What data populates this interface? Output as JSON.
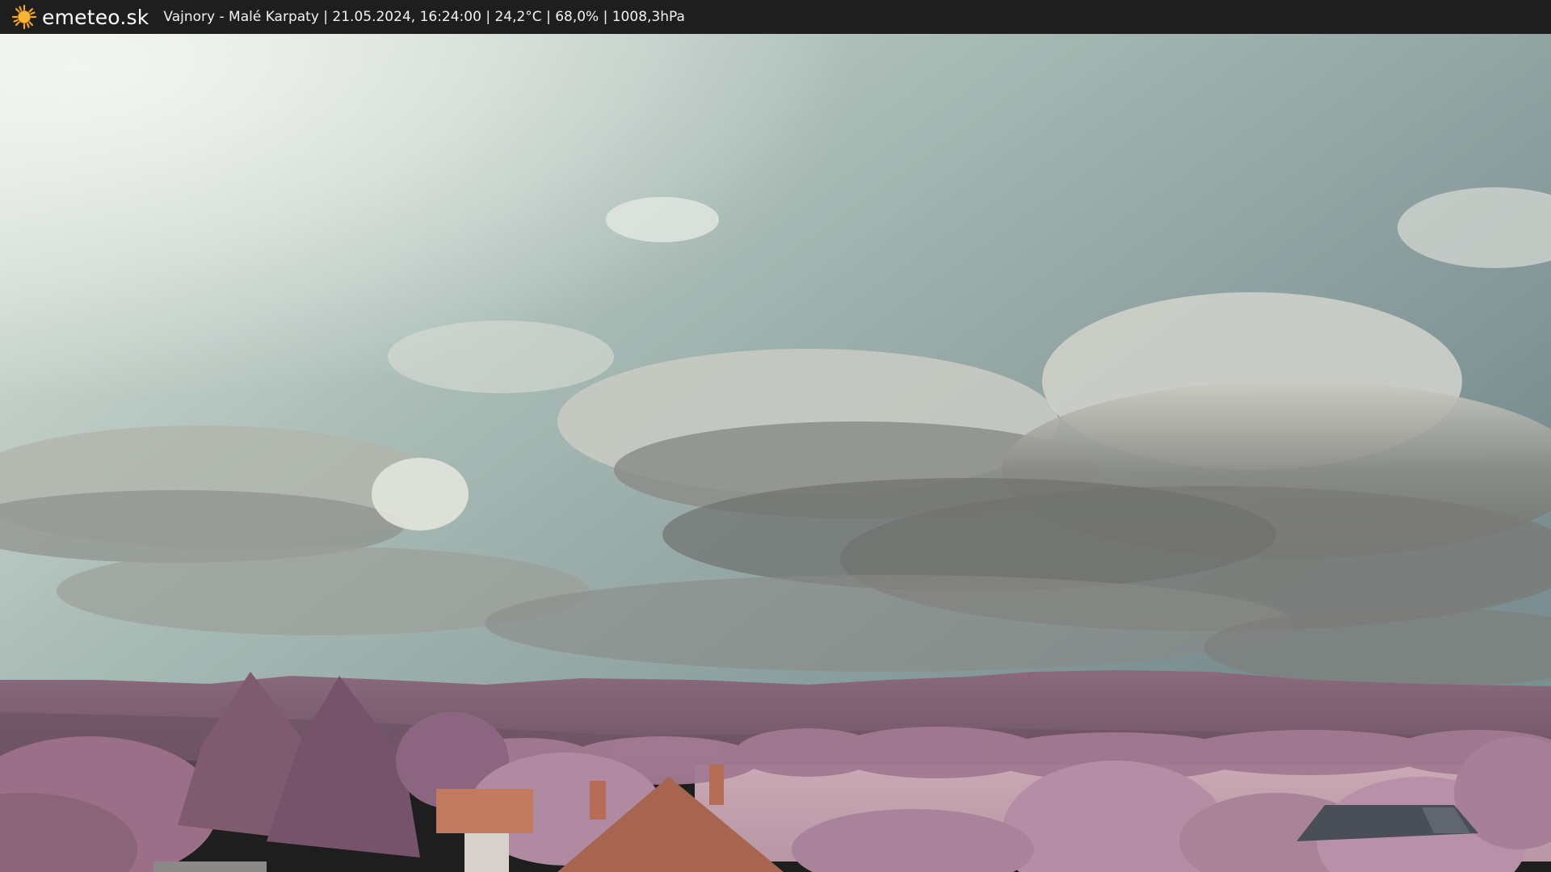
{
  "header": {
    "brand": "emeteo.sk",
    "logo_icon": "sun-icon",
    "info_text": "Vajnory - Malé Karpaty | 21.05.2024, 16:24:00 | 24,2°C | 68,0% | 1008,3hPa"
  },
  "colors": {
    "bar_background": "#1e1e1e",
    "logo_sun": "#f5a623",
    "foliage": "#a87b96",
    "sky": "#9fb2ad"
  }
}
